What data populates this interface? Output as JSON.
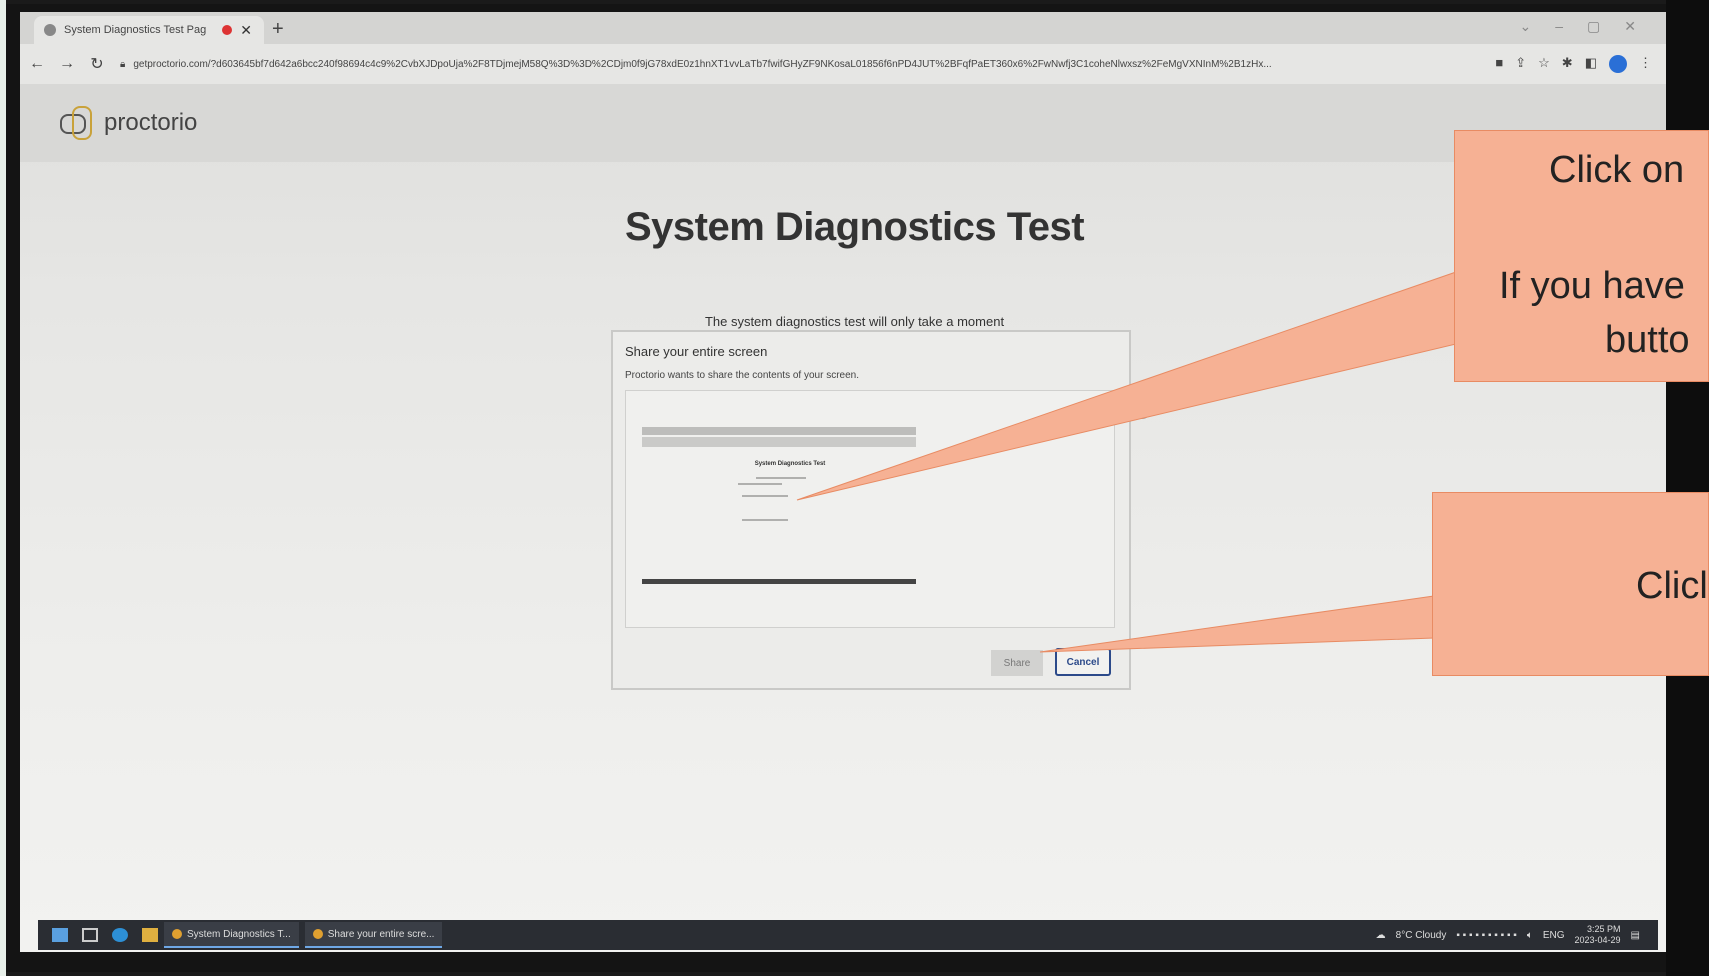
{
  "browser": {
    "tab_title": "System Diagnostics Test Pag",
    "new_tab_label": "+",
    "url": "getproctorio.com/?d603645bf7d642a6bcc240f98694c4c9%2CvbXJDpoUja%2F8TDjmejM58Q%3D%3D%2CDjm0f9jG78xdE0z1hnXT1vvLaTb7fwifGHyZF9NKosaL01856f6nPD4JUT%2BFqfPaET360x6%2FwNwfj3C1coheNlwxsz%2FeMgVXNInM%2B1zHx..."
  },
  "site": {
    "logo_text": "proctorio"
  },
  "page": {
    "title": "System Diagnostics Test",
    "subtitle": "The system diagnostics test will only take a moment"
  },
  "dialog": {
    "title": "Share your entire screen",
    "description": "Proctorio wants to share the contents of your screen.",
    "preview_title": "System Diagnostics Test",
    "share_label": "Share",
    "cancel_label": "Cancel"
  },
  "taskbar": {
    "apps": [
      {
        "label": "System Diagnostics T..."
      },
      {
        "label": "Share your entire scre..."
      }
    ],
    "weather": "8°C  Cloudy",
    "language": "ENG",
    "time": "3:25 PM",
    "date": "2023-04-29"
  },
  "callouts": {
    "callout1_line1": "Click on",
    "callout1_line2": "If you have",
    "callout1_line3": "butto",
    "callout2_line1": "Clicl"
  },
  "colors": {
    "callout_fill": "#f6b194",
    "callout_border": "#e88b63",
    "cancel_accent": "#2c4a8a"
  }
}
